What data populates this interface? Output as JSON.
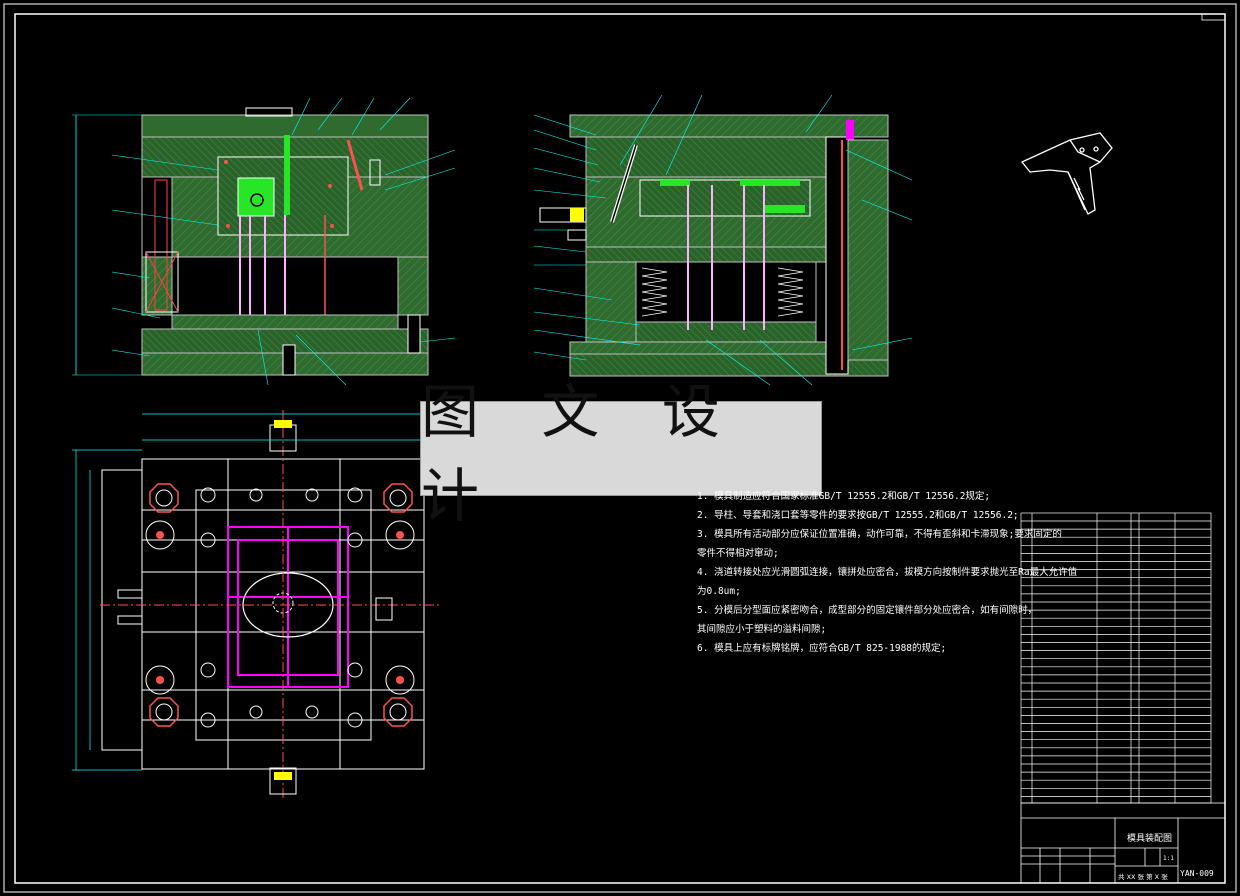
{
  "watermark": {
    "text": "图 文 设 计"
  },
  "notes": {
    "items": [
      "1. 模具制造应符合国家标准GB/T 12555.2和GB/T 12556.2规定;",
      "2. 导柱、导套和浇口套等零件的要求按GB/T 12555.2和GB/T 12556.2;",
      "3. 模具所有活动部分应保证位置准确，动作可靠，不得有歪斜和卡滞现象;要求固定的",
      "   零件不得相对窜动;",
      "4. 浇道转接处应光滑圆弧连接，镶拼处应密合，拔模方向按制件要求抛光至Ra最大允许值",
      "   为0.8um;",
      "5. 分模后分型面应紧密吻合，成型部分的固定镶件部分处应密合，如有间隙时，",
      "   其间隙应小于塑料的溢料间隙;",
      "6. 模具上应有标牌铭牌，应符合GB/T 825-1988的规定;"
    ]
  },
  "title_block": {
    "drawing_title": "模具装配图",
    "drawing_code": "YAN-009",
    "scale": "1:1",
    "sheet": "共 XX 张 第 X 张"
  },
  "colors": {
    "background": "#000000",
    "plate_fill": "#2f6b2f",
    "outline": "#ffffff",
    "dimension": "#00ffff",
    "section": "#ff00ff",
    "highlight": "#00ff00",
    "watermark_bg": "#d9d9d9"
  }
}
